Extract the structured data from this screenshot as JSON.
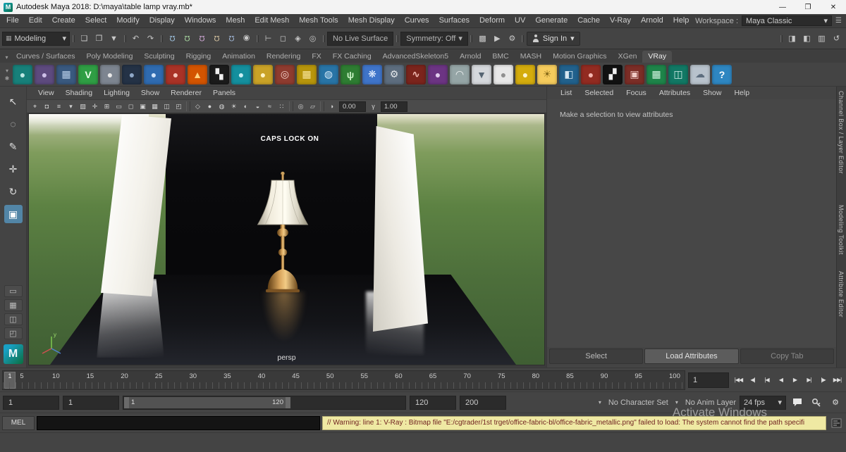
{
  "ui": {
    "caret_down": "▾",
    "grid_glyph": "▦"
  },
  "window": {
    "title": "Autodesk Maya 2018: D:\\maya\\table lamp vray.mb*",
    "app_icon_glyph": "M",
    "minimize_glyph": "—",
    "maximize_glyph": "❐",
    "close_glyph": "✕"
  },
  "menubar": {
    "items": [
      "File",
      "Edit",
      "Create",
      "Select",
      "Modify",
      "Display",
      "Windows",
      "Mesh",
      "Edit Mesh",
      "Mesh Tools",
      "Mesh Display",
      "Curves",
      "Surfaces",
      "Deform",
      "UV",
      "Generate",
      "Cache",
      "V-Ray",
      "Arnold",
      "Help"
    ],
    "workspace_label": "Workspace :",
    "workspace_value": "Maya Classic"
  },
  "statusline": {
    "mode": "Modeling",
    "live_surface": "No Live Surface",
    "symmetry": "Symmetry: Off",
    "sign_in": "Sign In",
    "file_icons": [
      {
        "name": "new-scene-icon",
        "glyph": "❏"
      },
      {
        "name": "open-scene-icon",
        "glyph": "❐"
      },
      {
        "name": "save-scene-icon",
        "glyph": "▼"
      }
    ],
    "edit_icons": [
      {
        "name": "undo-icon",
        "glyph": "↶"
      },
      {
        "name": "redo-icon",
        "glyph": "↷"
      }
    ],
    "snap_icons": [
      {
        "name": "snap-to-grids-icon",
        "glyph": "Ω",
        "color": "#9fc3e0"
      },
      {
        "name": "snap-to-curves-icon",
        "glyph": "Ω",
        "color": "#a8d6a0"
      },
      {
        "name": "snap-to-points-icon",
        "glyph": "Ω",
        "color": "#d0a8d6"
      },
      {
        "name": "snap-to-projected-center-icon",
        "glyph": "Ω",
        "color": "#d6c3a0"
      },
      {
        "name": "snap-to-view-planes-icon",
        "glyph": "Ω",
        "color": "#a0b6d6"
      },
      {
        "name": "make-live-icon",
        "glyph": "◉",
        "color": "#c8c8c8"
      }
    ],
    "selection_icons": [
      {
        "name": "select-hierarchy-icon",
        "glyph": "⊢"
      },
      {
        "name": "select-object-icon",
        "glyph": "◻"
      },
      {
        "name": "select-component-icon",
        "glyph": "◈"
      },
      {
        "name": "highlight-selection-icon",
        "glyph": "◎"
      }
    ],
    "render_icons": [
      {
        "name": "render-current-frame-icon",
        "glyph": "▩"
      },
      {
        "name": "ipr-render-icon",
        "glyph": "▶"
      },
      {
        "name": "render-settings-icon",
        "glyph": "⚙"
      }
    ],
    "panel_icons": [
      {
        "name": "attribute-editor-toggle-icon",
        "glyph": "◨"
      },
      {
        "name": "tool-settings-toggle-icon",
        "glyph": "◧"
      },
      {
        "name": "channel-box-toggle-icon",
        "glyph": "▥"
      },
      {
        "name": "workspace-reset-icon",
        "glyph": "↺"
      }
    ]
  },
  "shelf": {
    "menu_icon": "▾",
    "options_icon": "✱",
    "tabs": [
      {
        "label": "Curves / Surfaces"
      },
      {
        "label": "Poly Modeling"
      },
      {
        "label": "Sculpting"
      },
      {
        "label": "Rigging"
      },
      {
        "label": "Animation"
      },
      {
        "label": "Rendering"
      },
      {
        "label": "FX"
      },
      {
        "label": "FX Caching"
      },
      {
        "label": "AdvancedSkeleton5"
      },
      {
        "label": "Arnold"
      },
      {
        "label": "BMC"
      },
      {
        "label": "MASH"
      },
      {
        "label": "Motion Graphics"
      },
      {
        "label": "XGen"
      },
      {
        "label": "VRay",
        "active": true
      }
    ],
    "icons": [
      {
        "name": "vray-standard-material-icon",
        "glyph": "●",
        "bg": "#17807a",
        "fg": "#bfe8e4"
      },
      {
        "name": "vray-material-library-icon",
        "glyph": "●",
        "bg": "#5d4a7e",
        "fg": "#cdbfe8"
      },
      {
        "name": "vray-displacement-icon",
        "glyph": "▦",
        "bg": "#39597f",
        "fg": "#b9cfe8"
      },
      {
        "name": "vray-logo-icon",
        "glyph": "V",
        "bg": "#2f9e44",
        "fg": "#eaffea"
      },
      {
        "name": "vray-sphere-grey-icon",
        "glyph": "●",
        "bg": "#7d8590",
        "fg": "#e8e8e8"
      },
      {
        "name": "vray-night-sphere-icon",
        "glyph": "●",
        "bg": "#243246",
        "fg": "#8fa8c8"
      },
      {
        "name": "vray-blue-sphere-icon",
        "glyph": "●",
        "bg": "#2f6bb0",
        "fg": "#cfe2f8"
      },
      {
        "name": "vray-red-spheres-icon",
        "glyph": "●",
        "bg": "#a93226",
        "fg": "#f5c6bb"
      },
      {
        "name": "vray-fire-icon",
        "glyph": "▲",
        "bg": "#d35400",
        "fg": "#ffd27f"
      },
      {
        "name": "vray-checker-icon",
        "glyph": "▚",
        "bg": "#1b1b1b",
        "fg": "#f0f0f0"
      },
      {
        "name": "vray-water-drop-icon",
        "glyph": "●",
        "bg": "#148f9e",
        "fg": "#c8eef4"
      },
      {
        "name": "vray-glass-sphere-icon",
        "glyph": "●",
        "bg": "#c9a227",
        "fg": "#fff3c4"
      },
      {
        "name": "vray-ring-material-icon",
        "glyph": "◎",
        "bg": "#8e3b2f",
        "fg": "#f3d1c9"
      },
      {
        "name": "vray-sand-texture-icon",
        "glyph": "▦",
        "bg": "#b7950b",
        "fg": "#f9e79f"
      },
      {
        "name": "vray-earth-globe-icon",
        "glyph": "◍",
        "bg": "#2874a6",
        "fg": "#d6eaf8"
      },
      {
        "name": "vray-fur-grass-icon",
        "glyph": "ψ",
        "bg": "#2e7d32",
        "fg": "#c8f2c4"
      },
      {
        "name": "vray-snowflake-icon",
        "glyph": "❋",
        "bg": "#3f74c9",
        "fg": "#eaf2ff"
      },
      {
        "name": "vray-gear-icon",
        "glyph": "⚙",
        "bg": "#5d6d7e",
        "fg": "#e5e8eb"
      },
      {
        "name": "vray-hair-curve-icon",
        "glyph": "∿",
        "bg": "#7b241c",
        "fg": "#f2bcb4"
      },
      {
        "name": "vray-purple-sphere-icon",
        "glyph": "●",
        "bg": "#6c3483",
        "fg": "#e2cdee"
      },
      {
        "name": "vray-dome-light-icon",
        "glyph": "◠",
        "bg": "#95a5a6",
        "fg": "#f4f6f6"
      },
      {
        "name": "vray-cone-light-icon",
        "glyph": "▼",
        "bg": "#d5d8dc",
        "fg": "#566573"
      },
      {
        "name": "vray-white-sphere-icon",
        "glyph": "●",
        "bg": "#e8e8e8",
        "fg": "#909090"
      },
      {
        "name": "vray-gold-sphere-icon",
        "glyph": "●",
        "bg": "#d4ac0d",
        "fg": "#fcf3cf"
      },
      {
        "name": "vray-sun-light-icon",
        "glyph": "☀",
        "bg": "#f5cb5c",
        "fg": "#8a6d1a"
      },
      {
        "name": "vray-ramp-texture-icon",
        "glyph": "◧",
        "bg": "#21618c",
        "fg": "#d4e6f1"
      },
      {
        "name": "vray-red-dot-icon",
        "glyph": "●",
        "bg": "#922b21",
        "fg": "#f5b7b1"
      },
      {
        "name": "vray-checker-small-icon",
        "glyph": "▞",
        "bg": "#111111",
        "fg": "#ededed"
      },
      {
        "name": "vray-frame-buffer-icon",
        "glyph": "▣",
        "bg": "#7b2d26",
        "fg": "#f0c9c4"
      },
      {
        "name": "vray-uv-editor-icon",
        "glyph": "▦",
        "bg": "#1e8449",
        "fg": "#d5f5e3"
      },
      {
        "name": "vray-render-camera-icon",
        "glyph": "◫",
        "bg": "#117864",
        "fg": "#d0ece7"
      },
      {
        "name": "cloud-icon",
        "glyph": "☁",
        "bg": "#b8c2cc",
        "fg": "#5d6d7e"
      },
      {
        "name": "help-icon",
        "glyph": "?",
        "bg": "#2e86c1",
        "fg": "#ffffff"
      }
    ]
  },
  "toolbox": {
    "logo_glyph": "M",
    "tools": [
      {
        "name": "select-tool-button",
        "glyph": "↖"
      },
      {
        "name": "lasso-tool-button",
        "glyph": "◌"
      },
      {
        "name": "paint-select-tool-button",
        "glyph": "✎"
      },
      {
        "name": "move-tool-button",
        "glyph": "✛"
      },
      {
        "name": "rotate-tool-button",
        "glyph": "↻"
      },
      {
        "name": "scale-tool-button",
        "glyph": "▣",
        "active": true
      }
    ],
    "layout_buttons": [
      {
        "name": "single-pane-layout-button",
        "glyph": "▭"
      },
      {
        "name": "four-pane-layout-button",
        "glyph": "▦"
      },
      {
        "name": "persp-outliner-layout-button",
        "glyph": "◫"
      },
      {
        "name": "hypershade-persp-layout-button",
        "glyph": "◰"
      }
    ]
  },
  "viewport": {
    "menus": [
      "View",
      "Shading",
      "Lighting",
      "Show",
      "Renderer",
      "Panels"
    ],
    "icons_a": [
      {
        "name": "select-camera-icon",
        "glyph": "⌖"
      },
      {
        "name": "lock-camera-icon",
        "glyph": "◘"
      },
      {
        "name": "camera-attributes-icon",
        "glyph": "≡"
      },
      {
        "name": "bookmarks-icon",
        "glyph": "▾"
      },
      {
        "name": "image-plane-icon",
        "glyph": "▨"
      },
      {
        "name": "two-d-pan-zoom-icon",
        "glyph": "✛"
      },
      {
        "name": "grid-icon",
        "glyph": "⊞"
      },
      {
        "name": "film-gate-icon",
        "glyph": "▭"
      },
      {
        "name": "resolution-gate-icon",
        "glyph": "◻"
      },
      {
        "name": "gate-mask-icon",
        "glyph": "▣"
      },
      {
        "name": "field-chart-icon",
        "glyph": "▦"
      },
      {
        "name": "safe-action-icon",
        "glyph": "◫"
      },
      {
        "name": "safe-title-icon",
        "glyph": "◰"
      }
    ],
    "icons_b": [
      {
        "name": "wireframe-icon",
        "glyph": "◇"
      },
      {
        "name": "shaded-icon",
        "glyph": "●"
      },
      {
        "name": "textured-icon",
        "glyph": "◍"
      },
      {
        "name": "use-all-lights-icon",
        "glyph": "☀"
      },
      {
        "name": "shadows-icon",
        "glyph": "◐"
      },
      {
        "name": "ambient-occlusion-icon",
        "glyph": "◒"
      },
      {
        "name": "motion-blur-icon",
        "glyph": "≈"
      },
      {
        "name": "anti-aliasing-icon",
        "glyph": "∷"
      }
    ],
    "icons_c": [
      {
        "name": "isolate-select-icon",
        "glyph": "◎"
      },
      {
        "name": "x-ray-icon",
        "glyph": "▱"
      }
    ],
    "exposure_icon": "◑",
    "gamma_icon": "γ",
    "exposure": "0.00",
    "gamma": "1.00",
    "overlay_text": "CAPS LOCK ON",
    "camera_label": "persp",
    "axis_label": "y"
  },
  "attribute_editor": {
    "menus": [
      "List",
      "Selected",
      "Focus",
      "Attributes",
      "Show",
      "Help"
    ],
    "message": "Make a selection to view attributes",
    "buttons": [
      "Select",
      "Load Attributes",
      "Copy Tab"
    ]
  },
  "side_tabs": [
    "Channel Box / Layer Editor",
    "Modeling Toolkit",
    "Attribute Editor"
  ],
  "timeline": {
    "ticks": [
      "5",
      "10",
      "15",
      "20",
      "25",
      "30",
      "35",
      "40",
      "45",
      "50",
      "55",
      "60",
      "65",
      "70",
      "75",
      "80",
      "85",
      "90",
      "95",
      "100"
    ],
    "playhead_frame": "1",
    "current_frame": "1",
    "playback": [
      {
        "name": "go-to-start-button",
        "glyph": "|◀◀"
      },
      {
        "name": "step-back-frame-button",
        "glyph": "◀|"
      },
      {
        "name": "step-back-key-button",
        "glyph": "|◀"
      },
      {
        "name": "play-backwards-button",
        "glyph": "◀"
      },
      {
        "name": "play-forwards-button",
        "glyph": "▶"
      },
      {
        "name": "step-forward-key-button",
        "glyph": "▶|"
      },
      {
        "name": "step-forward-frame-button",
        "glyph": "|▶"
      },
      {
        "name": "go-to-end-button",
        "glyph": "▶▶|"
      }
    ]
  },
  "range": {
    "anim_start": "1",
    "play_start": "1",
    "inner_start": "1",
    "inner_end": "120",
    "play_end": "120",
    "anim_end": "200",
    "character_set": "No Character Set",
    "anim_layer": "No Anim Layer",
    "fps": "24 fps"
  },
  "commandline": {
    "label": "MEL",
    "warning": "// Warning: line 1: V-Ray : Bitmap file \"E:/cgtrader/1st trget/office-fabric-bl/office-fabric_metallic.png\" failed to load: The system cannot find the path specifi"
  },
  "watermark": "Activate Windows"
}
